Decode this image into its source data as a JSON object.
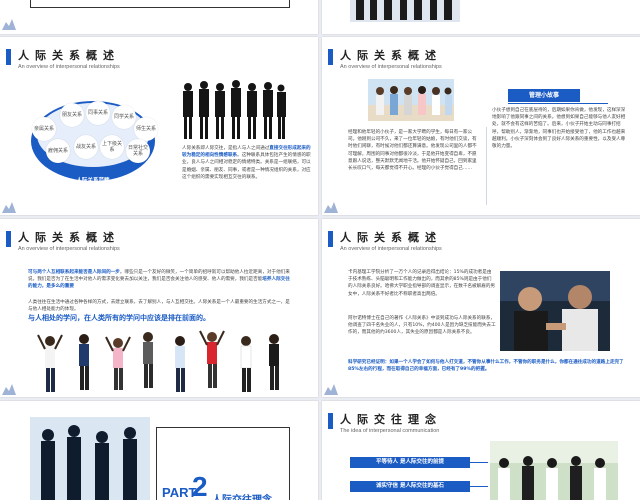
{
  "slides": [
    {
      "title": "人际关系概述",
      "subtitle": "An overview of interpersonal relationships",
      "diagram": {
        "center_label": "人际关系范畴",
        "bubbles": [
          "亲属关系",
          "朋友关系",
          "同事关系",
          "同学关系",
          "师生关系",
          "雇佣关系",
          "战友关系",
          "上下级关系",
          "日常社交关系"
        ]
      },
      "paragraph_before": "人际关系即人际交往，是指人与人之间通过",
      "paragraph_highlight": "直接交往形成起来的较为稳定的相向性情感联系",
      "paragraph_after": "。这种联系具体包括产生的情感的职业，良人与人之间相对稳定的情绪特类。关系是一组联络，可以是婚姻、亲属、朋友、同事，或者是一种情况组织的关系，对应这个组织的需要实现相互交往的联系。"
    },
    {
      "title": "人际关系概述",
      "subtitle": "An overview of interpersonal relationships",
      "badge": "管理小故事",
      "left_text": "经理和他年轻的小伙子，是一家大学聘的学生，每日有一家公司。他刚到公司不久，来了一位年轻的姑娘，有时他们交谈，有时他们闲聊，有时候对他们都还算满意。他发现公司里的人都不可理解，周围的同事对他都很冷淡，于是他开始变得自卑，不愿意跟人说话，整天默默无闻地干活。他开始怀疑自己，回到家里长长叹口气，每天都觉得不开心。经理的小伙子觉得自己……",
      "right_text": "小伙子想到自己在底层待的，后期如果你肯做，他发现，这样深深地影响了他跟同事之间的关系。他想到如果自己能够与他人友好相处，就不会有这样的苦恼了。后来，小伙子开始主动与同事打招呼，帮助别人，渐渐地，同事们也开始接受他了，他的工作也越来越顺利。小伙子深刻体会到了良好人际关系的重要性，以及受人尊敬的力量。"
    },
    {
      "title": "人际关系概述",
      "subtitle": "An overview of interpersonal relationships",
      "highlight1": "可与两个人互相联系起来能否是人际间的一步",
      "text1": "。哪些只是一个友好的微笑，一个简单的招呼就可以帮助他人拉近距离，对于他们来说，我们是否为了在生活中对他人的需求变化要去加以关注，我们是否会关注他人的感受、他人的需要，我们是否能",
      "highlight2": "培养人际交往的能力，是多么的重要",
      "text2": "人类往往在生活中通过各种各样的方式，去建立联系，去了解别人，与人互相交往。人际关系是一个人最重要的生活方式之一，是与他人相处能力的体现。",
      "quote": "与人相处的学问，在人类所有的学问中应该是排在前面的。"
    },
    {
      "title": "人际关系概述",
      "subtitle": "An overview of interpersonal relationships",
      "text1": "卡内基理工学院分析了一万个人的记录后得出结论：15%的成功者是由于技术熟练、头脑聪明和工作能力做出的，而其余的85%则是由于他们的人际关系良好。哈佛大学职业指导部的调查显示，在数千名被解雇的男女中，人际关系不好者比不称职者高出两倍。",
      "text2": "阿尔诺特博士在自己的著作《人际关系》中谈到成功与人际关系的联系，他调查了四千名失业的人，只有10%，约400人是因为缺乏技能而失去工作的，而其他的约3600人，其失业的原因都是人际关系不良。",
      "conclusion": "科学研究已经证明：如果一个人学会了如何与他人打交道，不管你从事什么工作，不管你的职务是什么，你都在通往成功的道路上走完了85%左右的行程，而在取得自己的幸福方面，已经有了99%的把握。"
    },
    {
      "part_label": "PART",
      "part_number": "2",
      "part_title": "人际交往理念"
    },
    {
      "title": "人际交往理念",
      "subtitle": "The idea of interpersonal communication",
      "pills": [
        "平等待人 是人际交往的前提",
        "诚实守信 是人际交往的基石"
      ]
    }
  ],
  "colors": {
    "accent": "#1a5bc4",
    "dark": "#0d2f6b"
  }
}
